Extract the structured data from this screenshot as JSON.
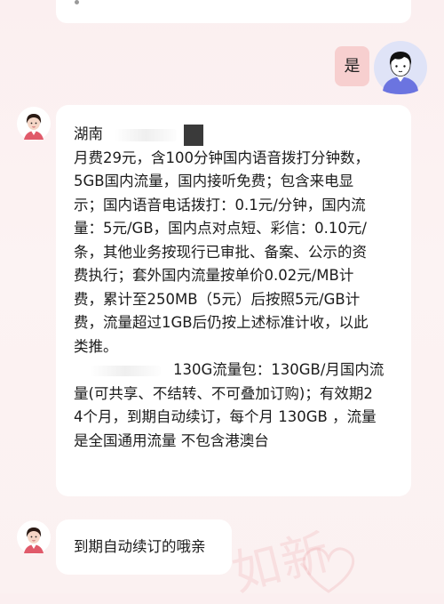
{
  "previous_message": {
    "text_visible": "g"
  },
  "user_reply": {
    "text": "是"
  },
  "agent_message": {
    "region": "湖南",
    "lines": [
      "月费29元，含100分钟国内语音拨打分钟数，",
      "5GB国内流量，国内接听免费；包含来电显",
      "示；国内语音电话拨打：0.1元/分钟，国内流",
      "量：5元/GB，国内点对点短、彩信：0.10元/",
      "条，其他业务按现行已审批、备案、公示的资",
      "费执行；套外国内流量按单价0.02元/MB计",
      "费，累计至250MB（5元）后按照5元/GB计",
      "费，流量超过1GB后仍按上述标准计收，以此",
      "类推。"
    ],
    "package_first_line": "130G流量包：130GB/月国内流",
    "package_lines": [
      "量(可共享、不结转、不可叠加订购)；有效期2",
      "4个月，到期自动续订，每个月 130GB ，流量",
      "是全国通用流量 不包含港澳台"
    ]
  },
  "agent_followup": {
    "text": "到期自动续订的哦亲"
  },
  "watermark": {
    "text": "如新"
  },
  "colors": {
    "background": "#fbeff0",
    "bubble": "#ffffff",
    "user_bubble": "#f7cfcf",
    "user_avatar_bg": "#dfe3f7",
    "user_avatar_shirt": "#6b74e0",
    "agent_uniform": "#e05a6a"
  }
}
